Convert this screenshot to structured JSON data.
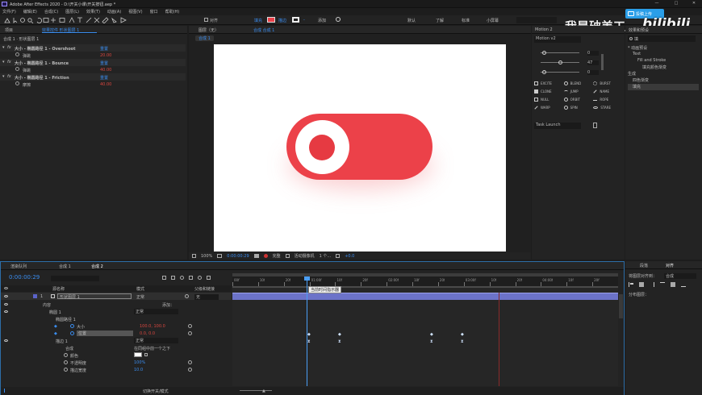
{
  "window": {
    "title": "Adobe After Effects 2020 - D:\\开关小课\\开关按钮.aep *",
    "min": "—",
    "max": "□",
    "close": "✕"
  },
  "menu": [
    "文件(F)",
    "编辑(E)",
    "合成(C)",
    "图层(L)",
    "效果(T)",
    "动画(A)",
    "视图(V)",
    "窗口",
    "帮助(H)"
  ],
  "toolbar": {
    "align_label": "对齐",
    "fill_label": "填充",
    "stroke_label": "描边",
    "stroke_value": "-",
    "add_label": "添加",
    "workspaces": [
      "默认",
      "了解",
      "标准",
      "小屏幕"
    ],
    "search_label": "搜索帮助"
  },
  "brand": {
    "upload_button": "投稿上传",
    "watermark_text": "我是破美工",
    "watermark_logo": "bilibili"
  },
  "left_panel": {
    "tabs": [
      "项目",
      "效果控件 形状图层 1"
    ],
    "header": "合成 1 · 形状图层 1",
    "effects": [
      {
        "name": "大小 - 椭圆路径 1 - Overshoot",
        "reset": "重置",
        "sub_label": "弹跳",
        "sub_value": "20.00"
      },
      {
        "name": "大小 - 椭圆路径 1 - Bounce",
        "reset": "重置",
        "sub_label": "弹跳",
        "sub_value": "40.00"
      },
      {
        "name": "大小 - 椭圆路径 1 - Friction",
        "reset": "重置",
        "sub_label": "摩擦",
        "sub_value": "40.00"
      }
    ]
  },
  "viewer": {
    "tabs": [
      "图层（无）",
      "合成 合成 1"
    ],
    "comp_chip": "合成 1",
    "colors": {
      "toggle": "#ec4149",
      "knob_outer": "#ffffff",
      "knob_inner": "#e63a42",
      "canvas": "#ffffff"
    },
    "zoom": "100%",
    "timecode": "0:00:00:29",
    "quality": "完整",
    "camera": "活动摄像机",
    "views": "1 个...",
    "exposure": "+0.0"
  },
  "motion_panel": {
    "title": "Motion 2",
    "preset": "Motion v2",
    "slider_values": [
      "0",
      "47",
      "0"
    ],
    "actions": [
      "EXCITE",
      "BLEND",
      "BURST",
      "CLONE",
      "JUMP",
      "NAME",
      "NULL",
      "ORBIT",
      "ROPE",
      "WARP",
      "SPIN",
      "STARE"
    ],
    "task_dropdown": "Task Launch"
  },
  "effects_panel": {
    "tabs": [
      "效果和预设"
    ],
    "search_value": "填",
    "tree": [
      {
        "label": "* 动画预设",
        "level": 0
      },
      {
        "label": "Text",
        "level": 1
      },
      {
        "label": "Fill and Stroke",
        "level": 2
      },
      {
        "label": "填充颜色渐变",
        "level": 3
      },
      {
        "label": "生成",
        "level": 0
      },
      {
        "label": "四色渐变",
        "level": 1
      },
      {
        "label": "填充",
        "level": 1,
        "selected": true
      }
    ]
  },
  "align_panel": {
    "tabs": [
      "段落",
      "对齐"
    ],
    "label": "将图层对齐到：",
    "target": "合成",
    "distribute_label": "分布图层："
  },
  "timeline": {
    "tabs": [
      "渲染队列",
      "合成 1",
      "合成 2"
    ],
    "timecode": "0:00:00:29",
    "columns": {
      "name": "源名称",
      "mode": "模式",
      "parent": "父级和链接"
    },
    "layer": {
      "number": "1",
      "name": "形状图层 1",
      "mode": "正常",
      "parent_value": "无"
    },
    "rows": [
      {
        "label": "内容",
        "indent": 1,
        "value": "",
        "extra": "添加："
      },
      {
        "label": "椭圆 1",
        "indent": 2,
        "value": "正常",
        "extra": ""
      },
      {
        "label": "椭圆路径 1",
        "indent": 3,
        "value": "",
        "extra": ""
      },
      {
        "label": "大小",
        "indent": 4,
        "value": "100.0, 100.0",
        "extra": "",
        "key": true
      },
      {
        "label": "位置",
        "indent": 4,
        "value": "0.0, 0.0",
        "extra": "",
        "key": true,
        "selected": true
      },
      {
        "label": "描边 1",
        "indent": 3,
        "value": "正常",
        "extra": ""
      },
      {
        "label": "合成",
        "indent": 4,
        "value": "在同组中前一个之下",
        "extra": ""
      },
      {
        "label": "颜色",
        "indent": 4,
        "value": "",
        "extra": ""
      },
      {
        "label": "不透明度",
        "indent": 4,
        "value": "100%",
        "extra": ""
      },
      {
        "label": "描边宽度",
        "indent": 4,
        "value": "10.0",
        "extra": ""
      }
    ],
    "ruler_labels": [
      "00f",
      "10f",
      "20f",
      "01:00f",
      "10f",
      "20f",
      "02:00f",
      "10f",
      "20f",
      "03:00f",
      "10f",
      "20f",
      "04:00f",
      "10f",
      "20f"
    ],
    "playhead_tooltip": "当前时间指示器",
    "footer": "切换开关/模式"
  }
}
